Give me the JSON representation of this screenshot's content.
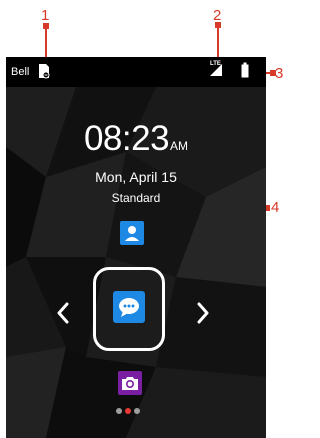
{
  "callouts": [
    "1",
    "2",
    "3",
    "4"
  ],
  "status_bar": {
    "carrier": "Bell",
    "network": "LTE",
    "icons": [
      "sim-icon",
      "lte-signal-icon",
      "battery-icon"
    ]
  },
  "lock_screen": {
    "time": "08:23",
    "ampm": "AM",
    "date": "Mon, April 15",
    "mode": "Standard",
    "shortcut_icons": [
      "contact-icon",
      "message-icon",
      "camera-icon"
    ],
    "nav_icons": [
      "chevron-left-icon",
      "chevron-right-icon"
    ],
    "page_count": 3,
    "active_page": 2
  },
  "colors": {
    "callout": "#d83a2a",
    "accent_blue": "#1e88e5",
    "camera_purple": "#7b1fa2",
    "active_dot": "#e53935"
  }
}
